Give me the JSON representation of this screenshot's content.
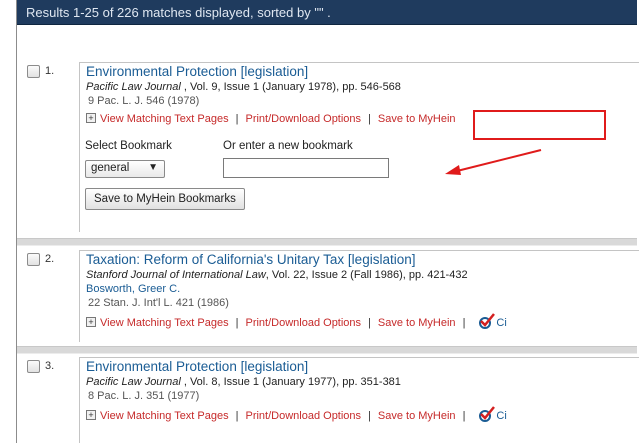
{
  "header": {
    "summary": "Results 1-25 of 226 matches displayed, sorted by \"\" ."
  },
  "actions": {
    "view_matching": "View Matching Text Pages",
    "print_download": "Print/Download Options",
    "save_to_myhein": "Save to MyHein",
    "separator": "|",
    "cite_truncated": "Ci"
  },
  "results": [
    {
      "number": "1.",
      "title": "Environmental Protection [legislation]",
      "journal": "Pacific Law Journal",
      "journal_rest": " , Vol. 9, Issue 1 (January 1978), pp. 546-568",
      "citation": "9 Pac. L. J. 546 (1978)"
    },
    {
      "number": "2.",
      "title": "Taxation: Reform of California's Unitary Tax [legislation]",
      "journal": "Stanford Journal of International Law",
      "journal_rest": ", Vol. 22, Issue 2 (Fall 1986), pp. 421-432",
      "author": "Bosworth, Greer C.",
      "citation": "22 Stan. J. Int'l L. 421 (1986)"
    },
    {
      "number": "3.",
      "title": "Environmental Protection [legislation]",
      "journal": "Pacific Law Journal",
      "journal_rest": " , Vol. 8, Issue 1 (January 1977), pp. 351-381",
      "citation": "8 Pac. L. J. 351 (1977)"
    }
  ],
  "bookmark": {
    "select_label": "Select Bookmark",
    "select_value": "general",
    "new_label": "Or enter a new bookmark",
    "new_value": "",
    "save_button": "Save to MyHein Bookmarks"
  },
  "colors": {
    "header_bg": "#1f3b5e",
    "link_blue": "#1a5c94",
    "action_red": "#c62a2a",
    "annotation_red": "#e01b1b"
  },
  "icons": {
    "expand": "plus-box-icon",
    "cite": "checkmark-icon",
    "select_caret": "caret-down-icon",
    "annotation_arrow": "arrow-icon"
  }
}
